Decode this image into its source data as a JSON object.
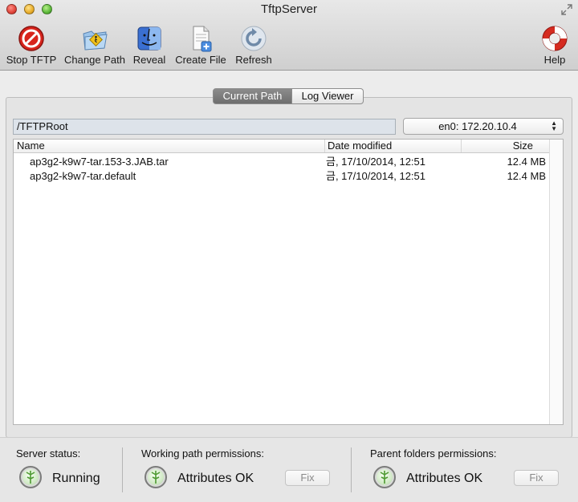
{
  "window": {
    "title": "TftpServer"
  },
  "toolbar": {
    "stop_label": "Stop TFTP",
    "change_path_label": "Change Path",
    "reveal_label": "Reveal",
    "create_file_label": "Create File",
    "refresh_label": "Refresh",
    "help_label": "Help"
  },
  "tabs": [
    {
      "label": "Current Path",
      "selected": true
    },
    {
      "label": "Log Viewer",
      "selected": false
    }
  ],
  "path": {
    "value": "/TFTPRoot"
  },
  "interface": {
    "selected": "en0: 172.20.10.4"
  },
  "table": {
    "columns": [
      "Name",
      "Date modified",
      "Size"
    ],
    "rows": [
      {
        "name": "ap3g2-k9w7-tar.153-3.JAB.tar",
        "date": "금, 17/10/2014, 12:51",
        "size": "12.4 MB"
      },
      {
        "name": "ap3g2-k9w7-tar.default",
        "date": "금, 17/10/2014, 12:51",
        "size": "12.4 MB"
      }
    ]
  },
  "status": {
    "server_title": "Server status:",
    "server_value": "Running",
    "working_title": "Working path permissions:",
    "working_value": "Attributes OK",
    "working_fix": "Fix",
    "parent_title": "Parent folders permissions:",
    "parent_value": "Attributes OK",
    "parent_fix": "Fix"
  },
  "icons": {
    "stop": "stop-sign-icon",
    "change_path": "folder-walker-icon",
    "reveal": "finder-icon",
    "create_file": "document-plus-icon",
    "refresh": "refresh-icon",
    "help": "lifebuoy-icon",
    "status_led": "green-led-icon"
  },
  "colors": {
    "selected_tab": "#7a7a7a",
    "led_green": "#5aa63c",
    "stop_red": "#d8241c"
  }
}
